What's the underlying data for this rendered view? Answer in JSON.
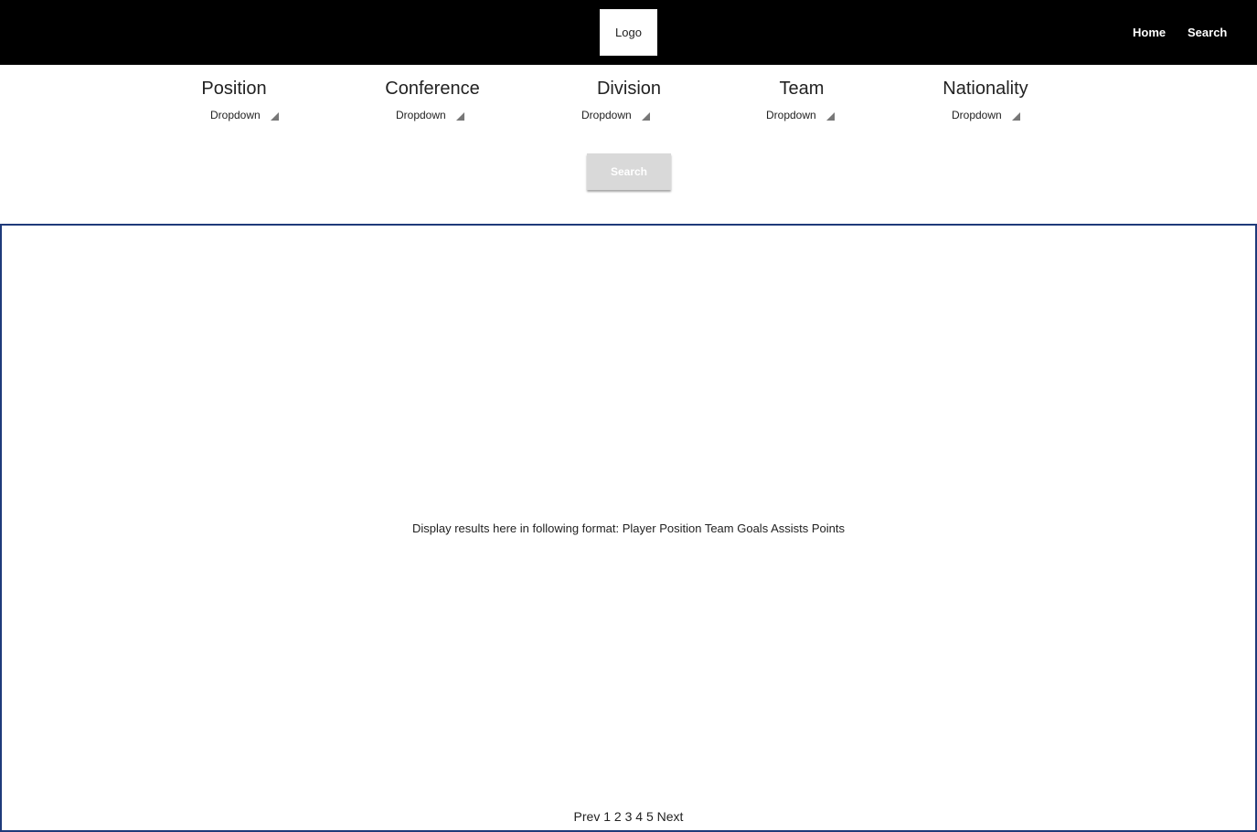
{
  "header": {
    "logo_label": "Logo",
    "nav": {
      "home": "Home",
      "search": "Search"
    }
  },
  "filters": [
    {
      "label": "Position",
      "value": "Dropdown"
    },
    {
      "label": "Conference",
      "value": "Dropdown"
    },
    {
      "label": "Division",
      "value": "Dropdown"
    },
    {
      "label": "Team",
      "value": "Dropdown"
    },
    {
      "label": "Nationality",
      "value": "Dropdown"
    }
  ],
  "search_button": "Search",
  "results": {
    "message": "Display results here in following format: Player Position Team Goals Assists Points"
  },
  "pagination": {
    "prev": "Prev",
    "pages": [
      "1",
      "2",
      "3",
      "4",
      "5"
    ],
    "next": "Next"
  },
  "colors": {
    "header_bg": "#000000",
    "results_border": "#1f3a7a",
    "button_bg": "#d9d9d9"
  }
}
